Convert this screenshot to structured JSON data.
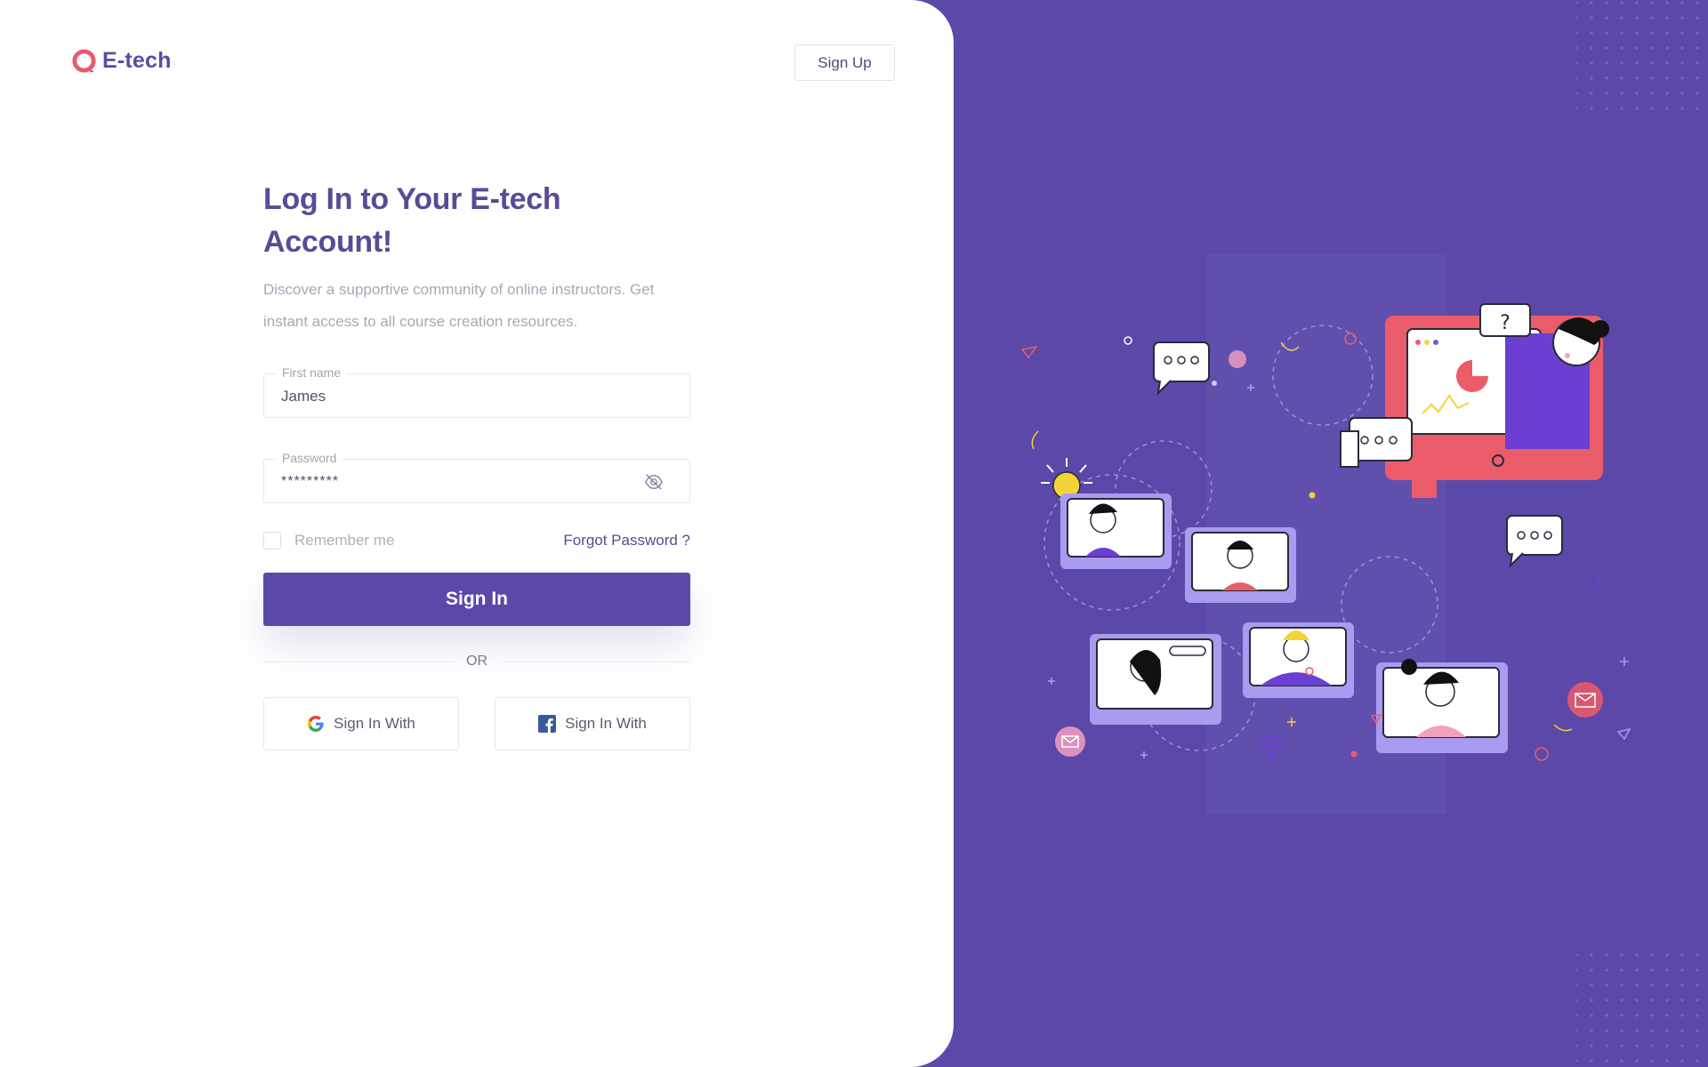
{
  "brand": {
    "name": "E-tech"
  },
  "header": {
    "signup_label": "Sign Up"
  },
  "form": {
    "title": "Log In to Your E-tech Account!",
    "subtitle": "Discover a supportive community of online instructors. Get instant access to all course creation resources.",
    "first_name": {
      "label": "First name",
      "value": "James"
    },
    "password": {
      "label": "Password",
      "value": "*********"
    },
    "remember_label": "Remember me",
    "remember_checked": false,
    "forgot_label": "Forgot Password ?",
    "signin_label": "Sign In",
    "or_label": "OR",
    "google_label": "Sign In With",
    "facebook_label": "Sign In With"
  },
  "colors": {
    "brand_purple": "#5c48a8",
    "logo_red": "#ea5a6b",
    "title_purple": "#5b4a96"
  },
  "icons": [
    "logo-mark-icon",
    "eye-off-icon",
    "google-icon",
    "facebook-icon"
  ]
}
